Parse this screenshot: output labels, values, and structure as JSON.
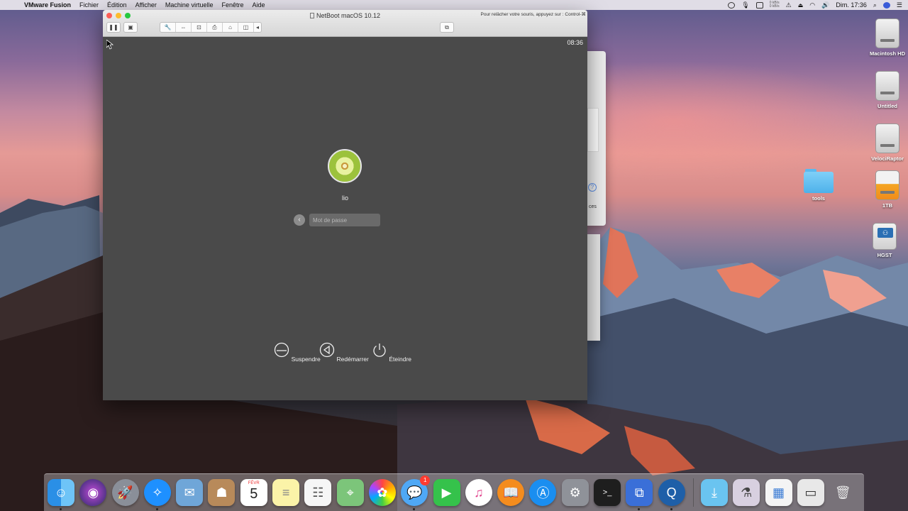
{
  "menubar": {
    "app_name": "VMware Fusion",
    "menus": [
      "Fichier",
      "Édition",
      "Afficher",
      "Machine virtuelle",
      "Fenêtre",
      "Aide"
    ],
    "clock": "Dim. 17:36",
    "net_up": "0 kB/s",
    "net_down": "0 kB/s"
  },
  "vm_window": {
    "title": "NetBoot macOS 10.12",
    "release_hint": "Pour relâcher votre souris, appuyez sur : Control-⌘",
    "guest": {
      "clock": "08:36",
      "username": "lio",
      "password_placeholder": "Mot de passe",
      "back_glyph": "‹",
      "buttons": {
        "sleep": "Suspendre",
        "restart": "Redémarrer",
        "shutdown": "Éteindre"
      }
    }
  },
  "background_window": {
    "help_glyph": "?",
    "label_fragment": "ces"
  },
  "desktop": {
    "icons": [
      {
        "label": "Macintosh HD"
      },
      {
        "label": "Untitled"
      },
      {
        "label": "VelociRaptor"
      },
      {
        "label": "1TB"
      },
      {
        "label": "HGST"
      },
      {
        "label": "tools"
      }
    ]
  },
  "dock": {
    "calendar": {
      "month": "FÉVR",
      "day": "5"
    },
    "messages_badge": "1",
    "apps": [
      "finder-icon",
      "siri-icon",
      "launchpad-icon",
      "safari-icon",
      "mail-icon",
      "contacts-icon",
      "calendar-icon",
      "notes-icon",
      "reminders-icon",
      "maps-icon",
      "photos-icon",
      "messages-icon",
      "facetime-icon",
      "itunes-icon",
      "ibooks-icon",
      "app-store-icon",
      "system-preferences-icon",
      "terminal-icon",
      "vmware-fusion-icon",
      "quicktime-icon",
      "downloads-folder-icon",
      "preview-icon",
      "screenshot-grid-icon",
      "window-manager-icon",
      "trash-icon"
    ]
  }
}
